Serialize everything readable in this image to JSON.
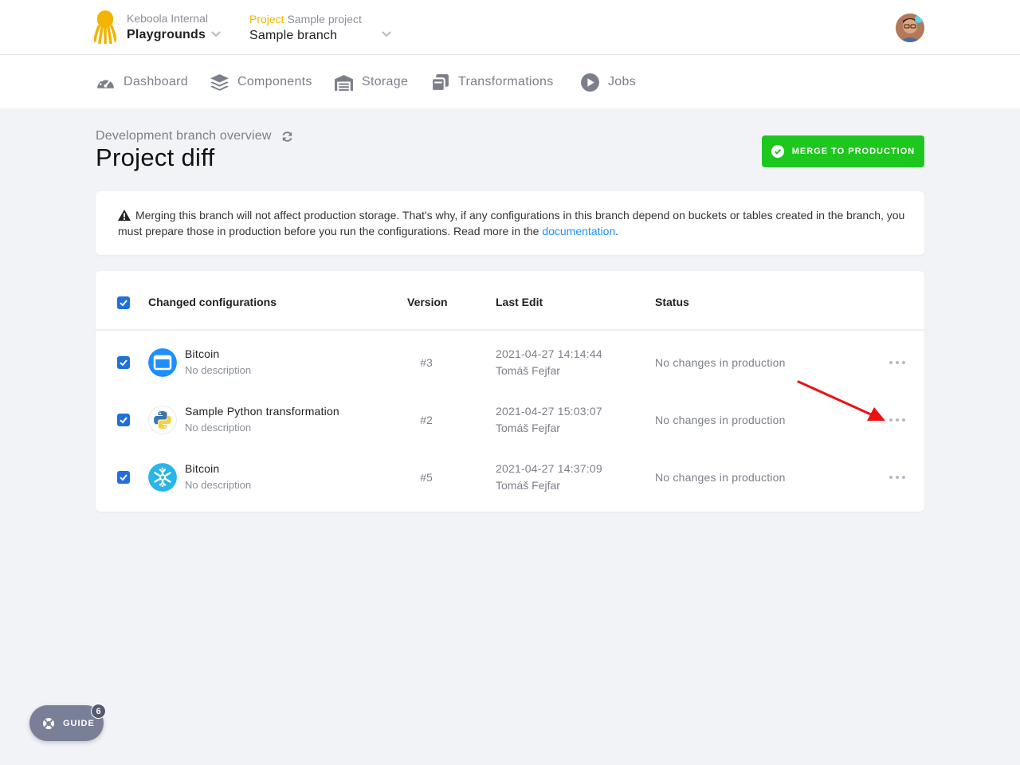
{
  "header": {
    "org_label": "Keboola Internal",
    "org_name": "Playgrounds",
    "project_label": "Project",
    "project_name": "Sample project",
    "branch_name": "Sample branch"
  },
  "nav": {
    "items": [
      {
        "label": "Dashboard",
        "icon": "dashboard-icon"
      },
      {
        "label": "Components",
        "icon": "layers-icon"
      },
      {
        "label": "Storage",
        "icon": "warehouse-icon"
      },
      {
        "label": "Transformations",
        "icon": "copy-icon"
      },
      {
        "label": "Jobs",
        "icon": "play-circle-icon"
      }
    ]
  },
  "page": {
    "breadcrumb": "Development branch overview",
    "title": "Project diff",
    "merge_label": "MERGE TO PRODUCTION"
  },
  "notice": {
    "text": "Merging this branch will not affect production storage. That's why, if any configurations in this branch depend on buckets or tables created in the branch, you must prepare those in production before you run the configurations. Read more in the ",
    "link": "documentation",
    "tail": "."
  },
  "table": {
    "columns": {
      "name": "Changed configurations",
      "version": "Version",
      "last_edit": "Last Edit",
      "status": "Status"
    },
    "rows": [
      {
        "name": "Bitcoin",
        "description": "No description",
        "version": "#3",
        "date": "2021-04-27 14:14:44",
        "user": "Tomáš Fejfar",
        "status": "No changes in production",
        "icon": "window-icon",
        "color": "#1f8fff"
      },
      {
        "name": "Sample Python transformation",
        "description": "No description",
        "version": "#2",
        "date": "2021-04-27 15:03:07",
        "user": "Tomáš Fejfar",
        "status": "No changes in production",
        "icon": "python-icon",
        "color": "#f3f3f3"
      },
      {
        "name": "Bitcoin",
        "description": "No description",
        "version": "#5",
        "date": "2021-04-27 14:37:09",
        "user": "Tomáš Fejfar",
        "status": "No changes in production",
        "icon": "snowflake-icon",
        "color": "#29b5e8"
      }
    ]
  },
  "guide": {
    "label": "GUIDE",
    "count": "6"
  },
  "colors": {
    "accent_green": "#1ec71e",
    "link_blue": "#1f8fff",
    "checkbox_blue": "#1f6fdd",
    "arrow_red": "#ee1111"
  }
}
